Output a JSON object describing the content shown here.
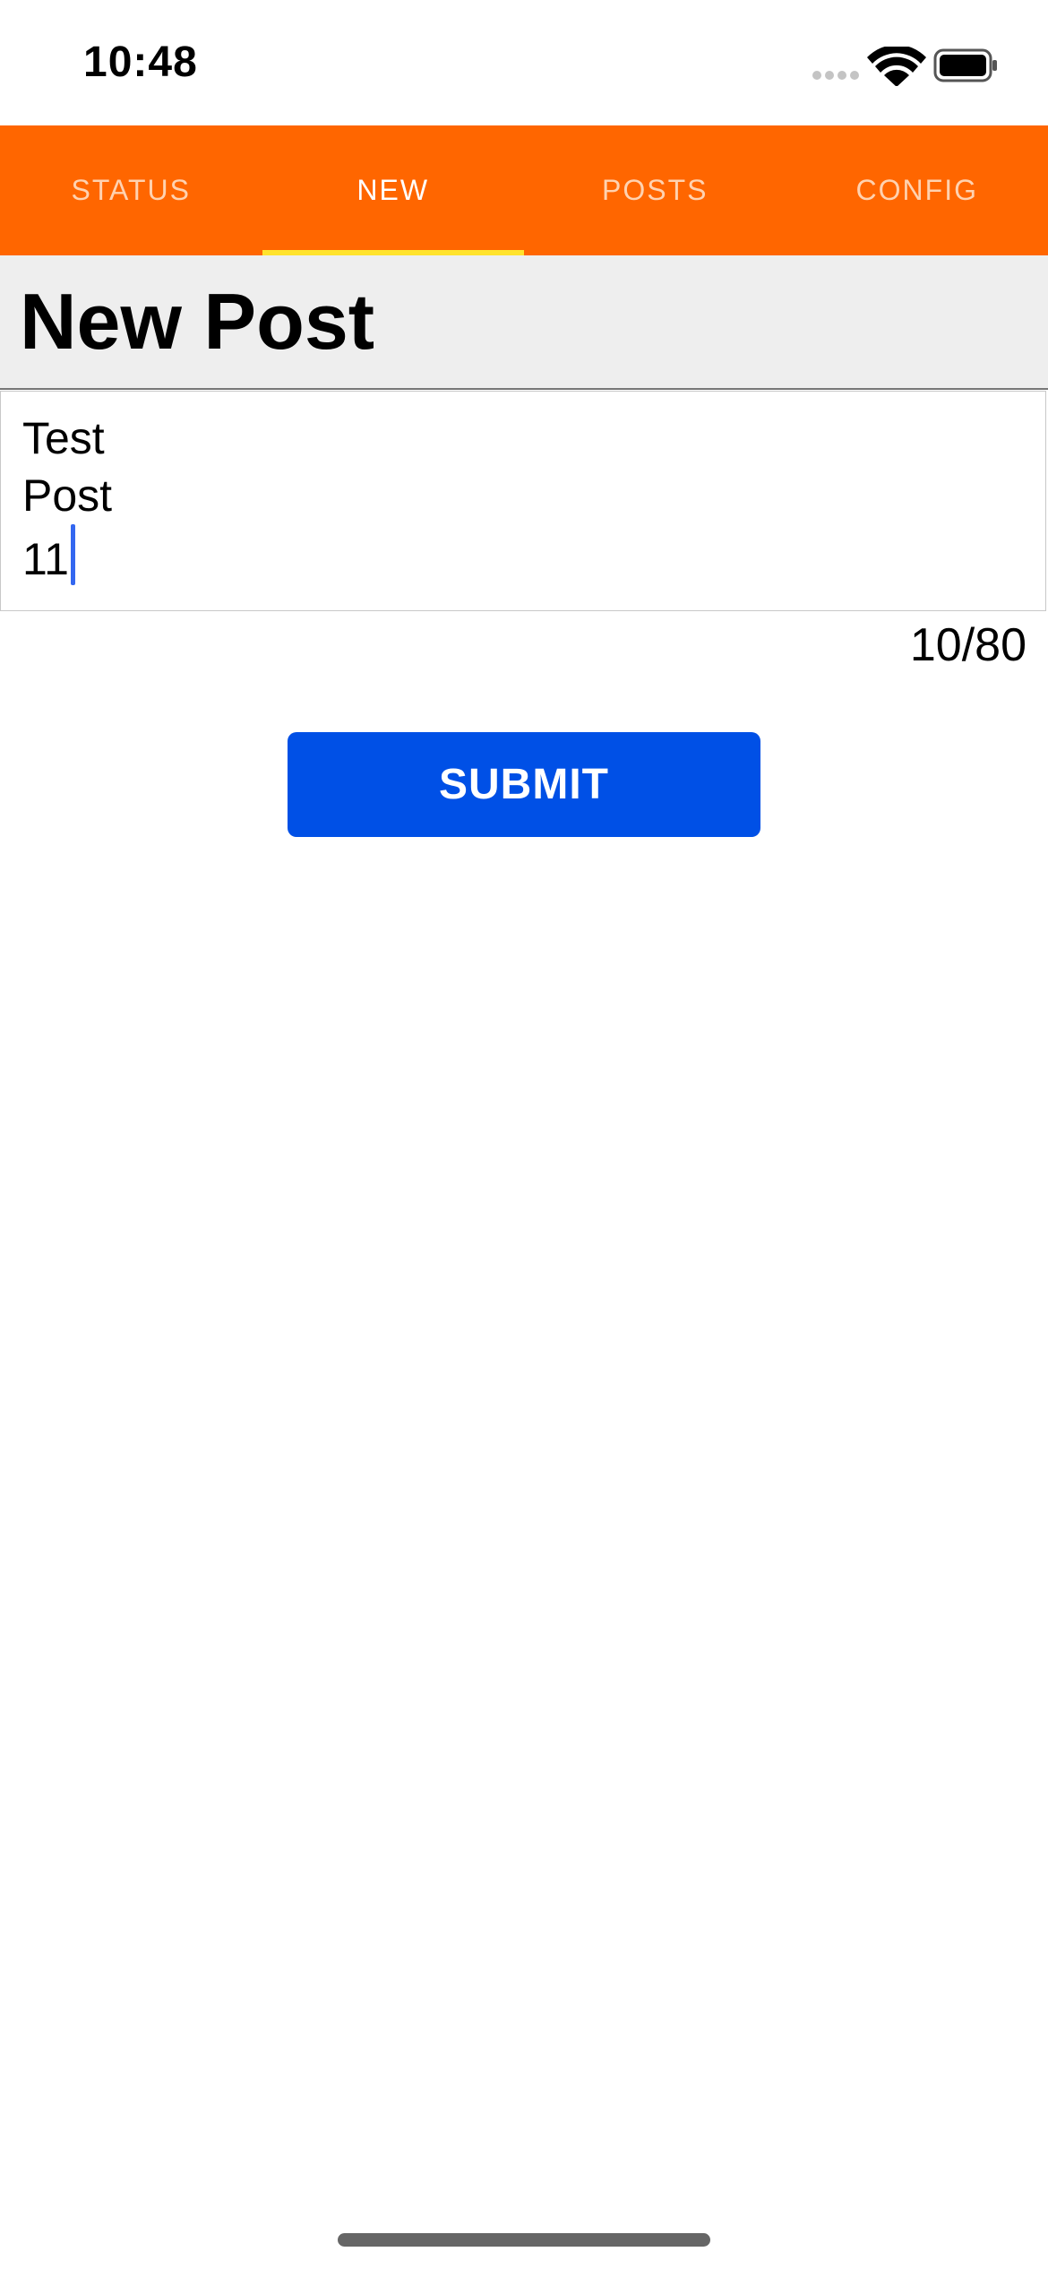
{
  "status_bar": {
    "time": "10:48",
    "icons": [
      "cellular-signal-icon",
      "wifi-icon",
      "battery-icon"
    ]
  },
  "colors": {
    "tab_bar_background": "#ff6600",
    "tab_text": "#ffd2b0",
    "tab_text_active": "#ffffff",
    "tab_indicator": "#ffe32d",
    "submit_background": "#0050e6",
    "caret": "#3367f0"
  },
  "tabs": [
    {
      "label": "STATUS",
      "active": false
    },
    {
      "label": "NEW",
      "active": true
    },
    {
      "label": "POSTS",
      "active": false
    },
    {
      "label": "CONFIG",
      "active": false
    }
  ],
  "page": {
    "title": "New Post"
  },
  "post_input": {
    "value": "Test\nPost\n11",
    "lines": [
      "Test",
      "Post",
      "11"
    ]
  },
  "char_counter": "10/80",
  "submit": {
    "label": "SUBMIT"
  }
}
